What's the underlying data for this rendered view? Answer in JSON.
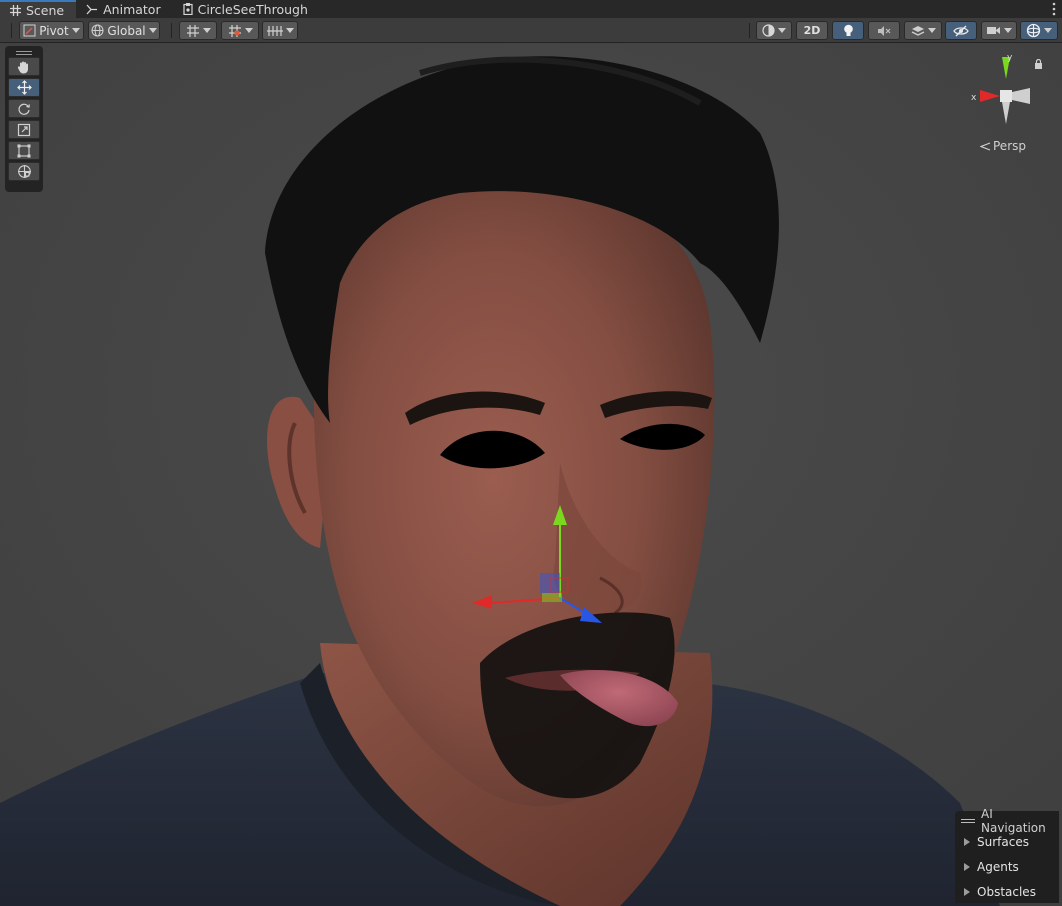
{
  "tabs": [
    {
      "label": "Scene",
      "icon": "grid-icon",
      "active": true
    },
    {
      "label": "Animator",
      "icon": "animator-icon",
      "active": false
    },
    {
      "label": "CircleSeeThrough",
      "icon": "script-icon",
      "active": false
    }
  ],
  "toolbar": {
    "pivot_label": "Pivot",
    "global_label": "Global",
    "mode_2d_label": "2D"
  },
  "tools": [
    "hand-tool",
    "move-tool",
    "rotate-tool",
    "scale-tool",
    "rect-tool",
    "transform-tool"
  ],
  "selected_tool": "move-tool",
  "gizmo": {
    "x_label": "x",
    "y_label": "y",
    "projection_label": "Persp"
  },
  "ai_navigation": {
    "title": "AI Navigation",
    "items": [
      {
        "label": "Surfaces"
      },
      {
        "label": "Agents"
      },
      {
        "label": "Obstacles"
      }
    ]
  },
  "colors": {
    "background": "#464646",
    "accent": "#3a79bb",
    "axis_x": "#e02a2a",
    "axis_y": "#7ad81e",
    "axis_z": "#2857e8",
    "skin": "#8c5548",
    "shirt": "#262c39"
  }
}
